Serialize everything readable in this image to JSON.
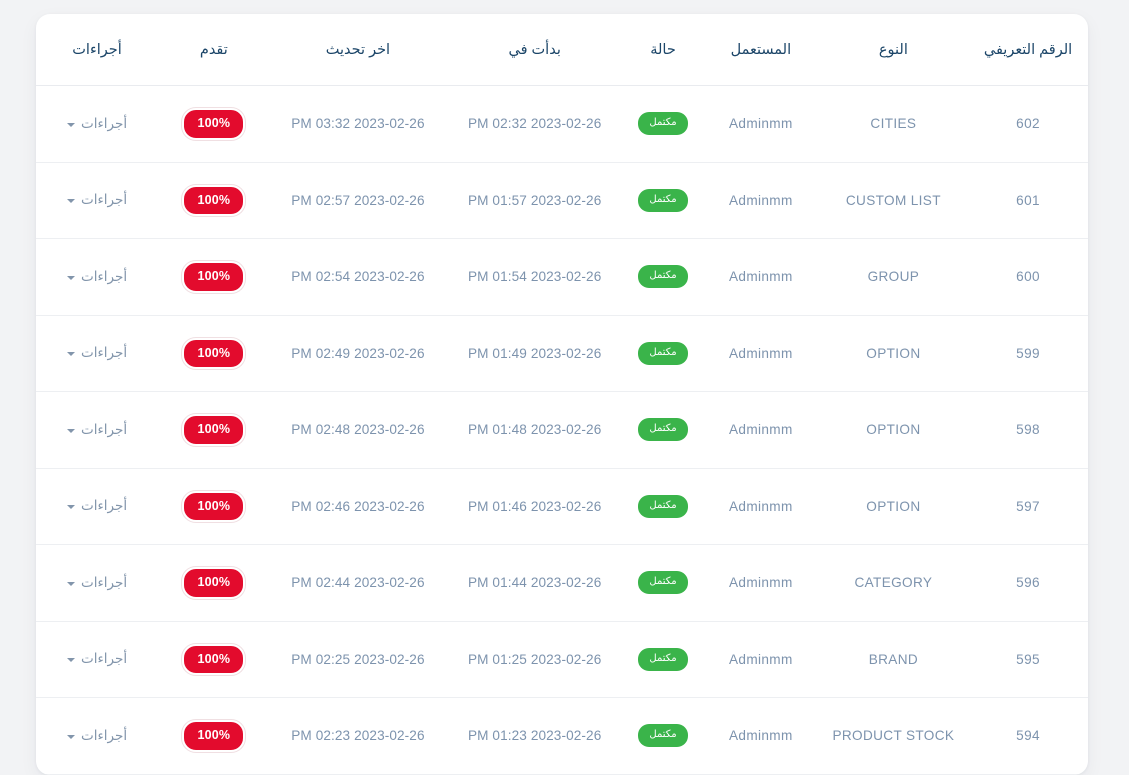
{
  "table": {
    "columns": [
      {
        "key": "id",
        "label": "الرقم التعريفي"
      },
      {
        "key": "type",
        "label": "النوع"
      },
      {
        "key": "user",
        "label": "المستعمل"
      },
      {
        "key": "state",
        "label": "حالة"
      },
      {
        "key": "started",
        "label": "بدأت في"
      },
      {
        "key": "updated",
        "label": "اخر تحديث"
      },
      {
        "key": "progress",
        "label": "تقدم"
      },
      {
        "key": "actions",
        "label": "أجراءات"
      }
    ],
    "rows": [
      {
        "id": "602",
        "type": "CITIES",
        "user": "Adminmm",
        "state": "مكتمل",
        "started": "PM 02:32 2023-02-26",
        "updated": "PM 03:32 2023-02-26",
        "progress": "100%",
        "actions": "أجراءات"
      },
      {
        "id": "601",
        "type": "CUSTOM LIST",
        "user": "Adminmm",
        "state": "مكتمل",
        "started": "PM 01:57 2023-02-26",
        "updated": "PM 02:57 2023-02-26",
        "progress": "100%",
        "actions": "أجراءات"
      },
      {
        "id": "600",
        "type": "GROUP",
        "user": "Adminmm",
        "state": "مكتمل",
        "started": "PM 01:54 2023-02-26",
        "updated": "PM 02:54 2023-02-26",
        "progress": "100%",
        "actions": "أجراءات"
      },
      {
        "id": "599",
        "type": "OPTION",
        "user": "Adminmm",
        "state": "مكتمل",
        "started": "PM 01:49 2023-02-26",
        "updated": "PM 02:49 2023-02-26",
        "progress": "100%",
        "actions": "أجراءات"
      },
      {
        "id": "598",
        "type": "OPTION",
        "user": "Adminmm",
        "state": "مكتمل",
        "started": "PM 01:48 2023-02-26",
        "updated": "PM 02:48 2023-02-26",
        "progress": "100%",
        "actions": "أجراءات"
      },
      {
        "id": "597",
        "type": "OPTION",
        "user": "Adminmm",
        "state": "مكتمل",
        "started": "PM 01:46 2023-02-26",
        "updated": "PM 02:46 2023-02-26",
        "progress": "100%",
        "actions": "أجراءات"
      },
      {
        "id": "596",
        "type": "CATEGORY",
        "user": "Adminmm",
        "state": "مكتمل",
        "started": "PM 01:44 2023-02-26",
        "updated": "PM 02:44 2023-02-26",
        "progress": "100%",
        "actions": "أجراءات"
      },
      {
        "id": "595",
        "type": "BRAND",
        "user": "Adminmm",
        "state": "مكتمل",
        "started": "PM 01:25 2023-02-26",
        "updated": "PM 02:25 2023-02-26",
        "progress": "100%",
        "actions": "أجراءات"
      },
      {
        "id": "594",
        "type": "PRODUCT STOCK",
        "user": "Adminmm",
        "state": "مكتمل",
        "started": "PM 01:23 2023-02-26",
        "updated": "PM 02:23 2023-02-26",
        "progress": "100%",
        "actions": "أجراءات"
      }
    ]
  },
  "theme": {
    "page_background": "#f2f3f5",
    "card_background": "#ffffff",
    "header_text": "#1b4568",
    "body_text": "#7d93ad",
    "status_badge": "#3ab44a",
    "progress_badge": "#e30b2d",
    "row_divider": "#edeff2"
  }
}
